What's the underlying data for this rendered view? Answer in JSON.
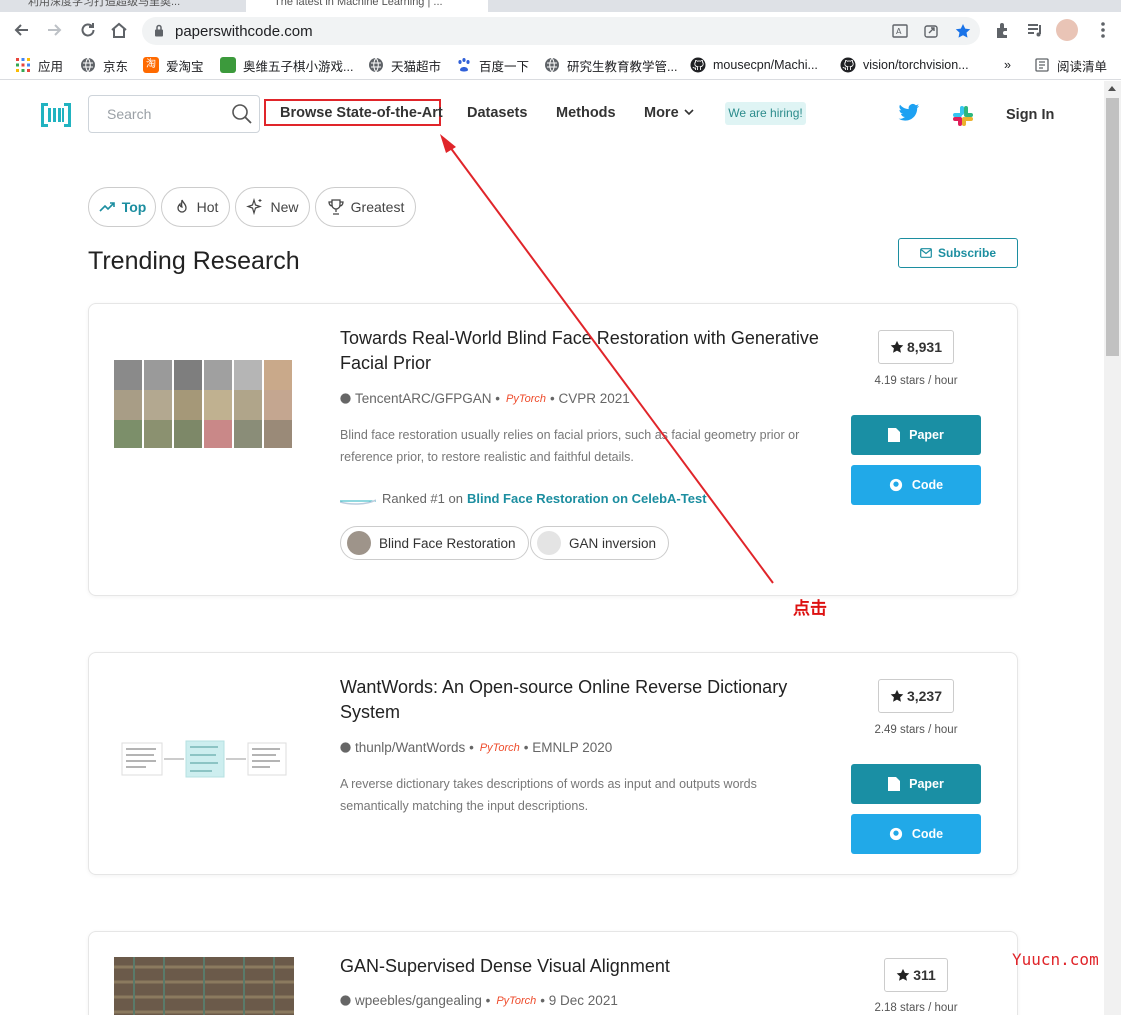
{
  "browser": {
    "tabs": [
      {
        "title": "利用深度学习打造超级马里奥..."
      },
      {
        "title": "The latest in Machine Learning | ..."
      }
    ],
    "url": "paperswithcode.com",
    "bookmarks": [
      {
        "label": "应用",
        "icon": "apps-grid-icon",
        "color": "#e8453c"
      },
      {
        "label": "京东",
        "icon": "globe-icon",
        "color": "#5f6368"
      },
      {
        "label": "爱淘宝",
        "icon": "taobao-icon",
        "color": "#ff6a00"
      },
      {
        "label": "奥维五子棋小游戏...",
        "icon": "game-icon",
        "color": "#3c9a3c"
      },
      {
        "label": "天猫超市",
        "icon": "globe-icon",
        "color": "#5f6368"
      },
      {
        "label": "百度一下",
        "icon": "baidu-paw-icon",
        "color": "#3060d8"
      },
      {
        "label": "研究生教育教学管...",
        "icon": "globe-icon",
        "color": "#5f6368"
      },
      {
        "label": "mousecpn/Machi...",
        "icon": "github-icon",
        "color": "#202124"
      },
      {
        "label": "vision/torchvision...",
        "icon": "github-icon",
        "color": "#202124"
      }
    ],
    "bookmarks_more": "»",
    "reading_list": "阅读清单"
  },
  "nav": {
    "search_placeholder": "Search",
    "links": [
      "Browse State-of-the-Art",
      "Datasets",
      "Methods",
      "More"
    ],
    "hiring": "We are hiring!",
    "sign_in": "Sign In"
  },
  "filters": [
    {
      "label": "Top",
      "icon": "trending-up-icon",
      "active": true
    },
    {
      "label": "Hot",
      "icon": "flame-icon",
      "active": false
    },
    {
      "label": "New",
      "icon": "sparkle-icon",
      "active": false
    },
    {
      "label": "Greatest",
      "icon": "trophy-icon",
      "active": false
    }
  ],
  "main": {
    "title": "Trending Research",
    "subscribe": "Subscribe"
  },
  "papers": [
    {
      "title": "Towards Real-World Blind Face Restoration with Generative Facial Prior",
      "repo": "TencentARC/GFPGAN",
      "framework": "PyTorch",
      "venue": "CVPR 2021",
      "abstract": "Blind face restoration usually relies on facial priors, such as facial geometry prior or reference prior, to restore realistic and faithful details.",
      "rank_prefix": "Ranked #1 on",
      "rank_link": "Blind Face Restoration on CelebA-Test",
      "tags": [
        "Blind Face Restoration",
        "GAN inversion"
      ],
      "stars": "8,931",
      "stars_per_hour": "4.19 stars / hour",
      "paper_btn": "Paper",
      "code_btn": "Code"
    },
    {
      "title": "WantWords: An Open-source Online Reverse Dictionary System",
      "repo": "thunlp/WantWords",
      "framework": "PyTorch",
      "venue": "EMNLP 2020",
      "abstract": "A reverse dictionary takes descriptions of words as input and outputs words semantically matching the input descriptions.",
      "stars": "3,237",
      "stars_per_hour": "2.49 stars / hour",
      "paper_btn": "Paper",
      "code_btn": "Code"
    },
    {
      "title": "GAN-Supervised Dense Visual Alignment",
      "repo": "wpeebles/gangealing",
      "framework": "PyTorch",
      "venue": "9 Dec 2021",
      "stars": "311",
      "stars_per_hour": "2.18 stars / hour"
    }
  ],
  "annotation": {
    "click_label": "点击",
    "color": "#e0252a"
  },
  "watermark": "Yuucn.com",
  "colors": {
    "accent_teal": "#1a8fa4",
    "code_blue": "#21a9e8",
    "highlight_red": "#e0252a"
  }
}
